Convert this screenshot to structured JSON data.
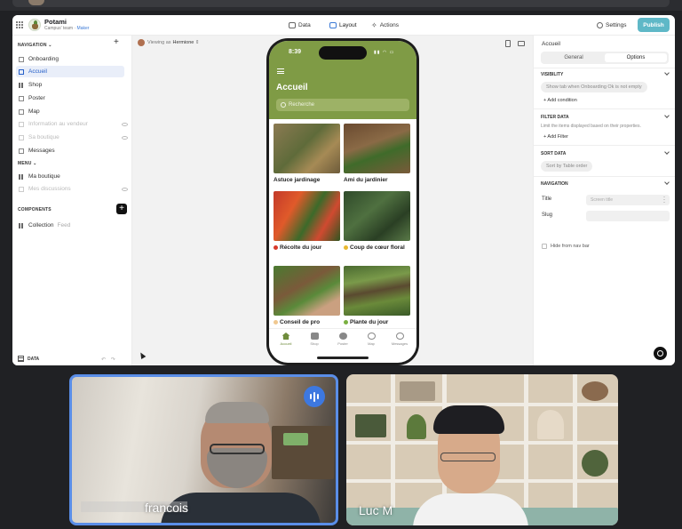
{
  "header": {
    "app_name": "Potami",
    "team": "Campus' team · ",
    "role": "Maker",
    "nav": {
      "data": "Data",
      "layout": "Layout",
      "actions": "Actions"
    },
    "settings": "Settings",
    "publish": "Publish"
  },
  "left": {
    "navigation_title": "NAVIGATION",
    "navigation_items": [
      {
        "label": "Onboarding"
      },
      {
        "label": "Accueil"
      },
      {
        "label": "Shop"
      },
      {
        "label": "Poster"
      },
      {
        "label": "Map"
      },
      {
        "label": "Information au vendeur"
      },
      {
        "label": "Sa boutique"
      },
      {
        "label": "Messages"
      }
    ],
    "menu_title": "MENU",
    "menu_items": [
      {
        "label": "Ma boutique"
      },
      {
        "label": "Mes discussions"
      }
    ],
    "components_title": "COMPONENTS",
    "component": {
      "label": "Collection",
      "tag": "Feed"
    },
    "footer": "DATA"
  },
  "canvas": {
    "viewing_label": "Viewing as",
    "viewing_user": "Hermione",
    "phone": {
      "time": "8:39",
      "title": "Accueil",
      "search_placeholder": "Recherche",
      "cards": [
        {
          "caption": "Astuce jardinage"
        },
        {
          "caption": "Ami du jardinier"
        },
        {
          "caption": "Récolte du jour"
        },
        {
          "caption": "Coup de cœur floral"
        },
        {
          "caption": "Conseil de pro"
        },
        {
          "caption": "Plante du jour"
        }
      ],
      "tabs": [
        "Accueil",
        "Shop",
        "Poster",
        "Map",
        "Messages"
      ]
    }
  },
  "right": {
    "title": "Accueil",
    "tabs": {
      "general": "General",
      "options": "Options"
    },
    "visibility": "VISIBILITY",
    "visibility_chip": "Show tab when Onboarding Ok is not empty",
    "add_condition": "+ Add condition",
    "filter_data": "FILTER DATA",
    "filter_note": "Limit the items displayed based on their properties.",
    "add_filter": "+ Add Filter",
    "sort_data": "SORT DATA",
    "sort_chip": "Sort by Table order",
    "navigation": "NAVIGATION",
    "title_label": "Title",
    "title_placeholder": "Screen title",
    "slug_label": "Slug",
    "hide_label": "Hide from nav bar"
  },
  "call": {
    "participants": [
      {
        "name": "francois"
      },
      {
        "name": "Luc M"
      }
    ]
  }
}
